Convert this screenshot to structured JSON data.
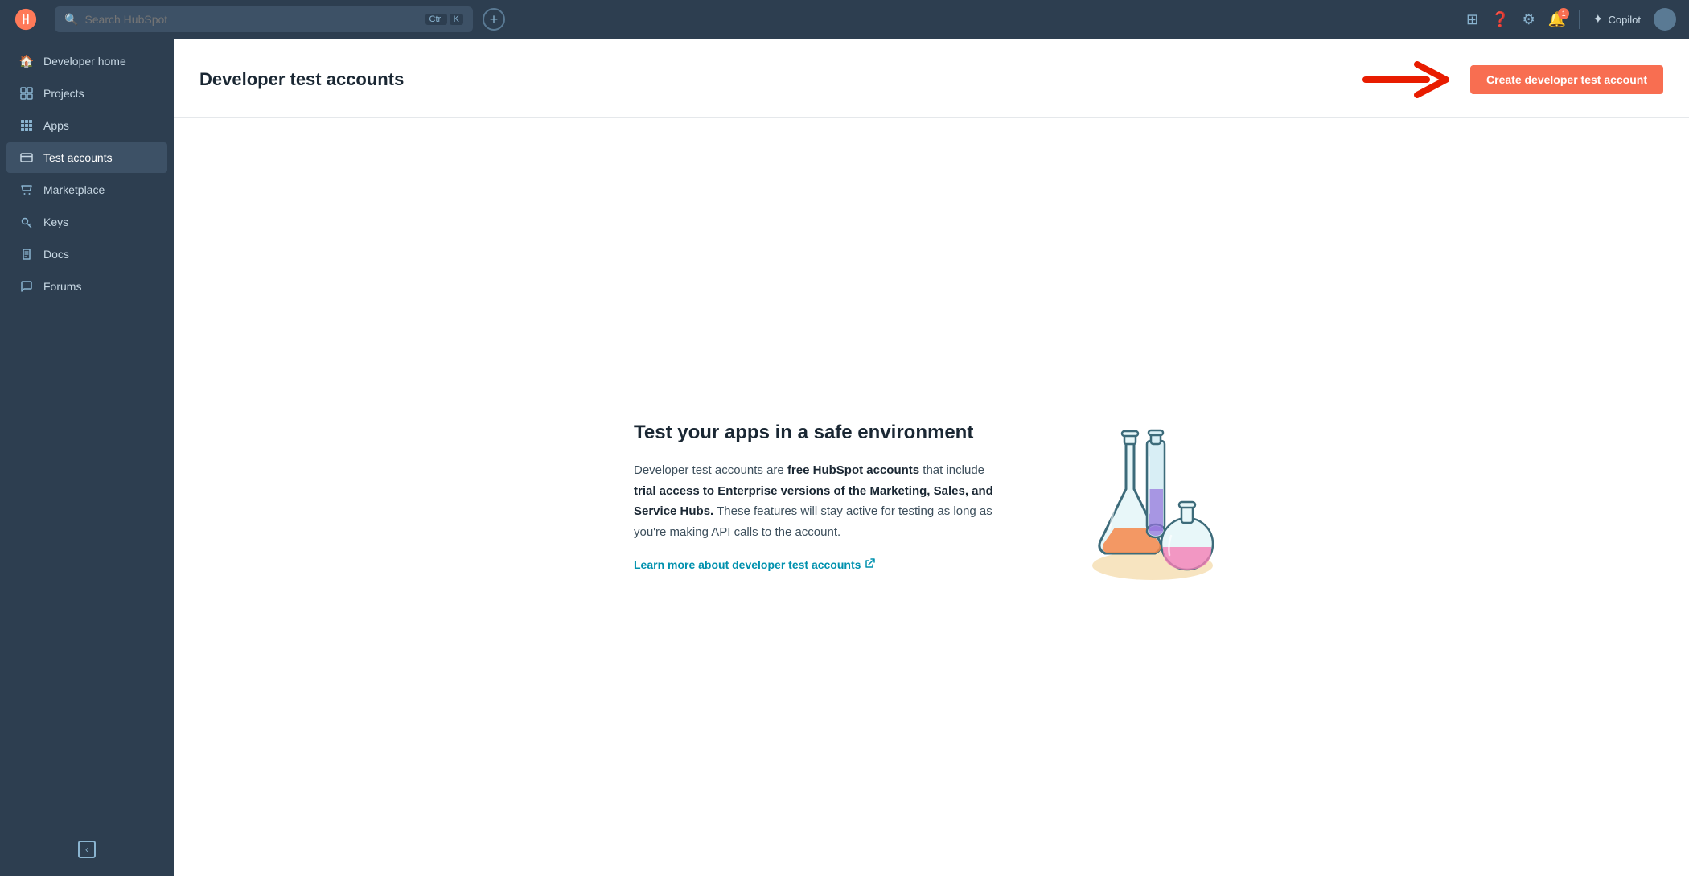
{
  "topNav": {
    "searchPlaceholder": "Search HubSpot",
    "shortcutCtrl": "Ctrl",
    "shortcutKey": "K",
    "addButtonLabel": "+",
    "copilotLabel": "Copilot",
    "notificationCount": "1"
  },
  "sidebar": {
    "items": [
      {
        "id": "developer-home",
        "label": "Developer home",
        "icon": "🏠"
      },
      {
        "id": "projects",
        "label": "Projects",
        "icon": "⊞"
      },
      {
        "id": "apps",
        "label": "Apps",
        "icon": "▦"
      },
      {
        "id": "test-accounts",
        "label": "Test accounts",
        "icon": "⊟",
        "active": true
      },
      {
        "id": "marketplace",
        "label": "Marketplace",
        "icon": "🛒"
      },
      {
        "id": "keys",
        "label": "Keys",
        "icon": "✱"
      },
      {
        "id": "docs",
        "label": "Docs",
        "icon": "⟨/⟩"
      },
      {
        "id": "forums",
        "label": "Forums",
        "icon": "☁"
      }
    ],
    "collapseLabel": "‹"
  },
  "pageHeader": {
    "title": "Developer test accounts",
    "createButtonLabel": "Create developer test account"
  },
  "emptyState": {
    "title": "Test your apps in a safe environment",
    "bodyStart": "Developer test accounts are ",
    "bodyBold1": "free HubSpot accounts",
    "bodyMid": " that include ",
    "bodyBold2": "trial access to Enterprise versions of the Marketing, Sales, and Service Hubs.",
    "bodyEnd": " These features will stay active for testing as long as you're making API calls to the account.",
    "linkLabel": "Learn more about developer test accounts",
    "linkIcon": "↗"
  }
}
